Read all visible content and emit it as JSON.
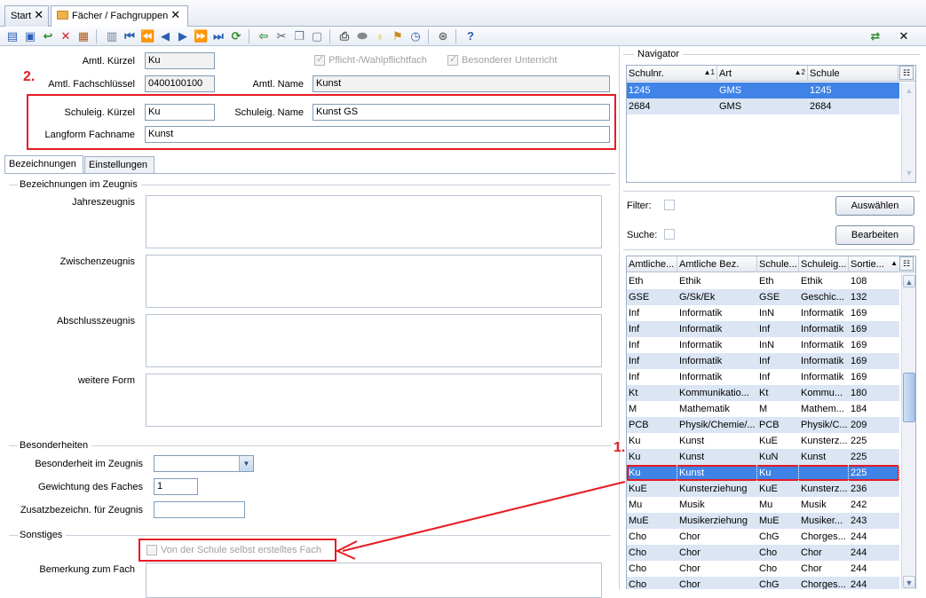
{
  "tabs": [
    {
      "label": "Start"
    },
    {
      "label": "Fächer / Fachgruppen"
    }
  ],
  "toolbar_icons": [
    "new-icon",
    "save-icon",
    "undo-icon",
    "delete-icon",
    "form-icon",
    "print-preview-icon",
    "first-icon",
    "prev-page-icon",
    "prev-icon",
    "next-icon",
    "next-page-icon",
    "last-icon",
    "refresh-icon",
    "back-arrow-icon",
    "cut-icon",
    "copy-icon",
    "paste-icon",
    "printer-icon",
    "toggle-icon",
    "lightbulb-icon",
    "broom-icon",
    "clock-icon",
    "filter-icon",
    "help-icon",
    "exchange-icon",
    "close-icon"
  ],
  "form": {
    "amtl_kuerzel_label": "Amtl. Kürzel",
    "amtl_kuerzel": "Ku",
    "pflicht_label": "Pflicht-/Wahlpflichtfach",
    "besonderer_label": "Besonderer Unterricht",
    "amtl_fachschluessel_label": "Amtl.  Fachschlüssel",
    "amtl_fachschluessel": "0400100100",
    "amtl_name_label": "Amtl. Name",
    "amtl_name": "Kunst",
    "schuleig_kuerzel_label": "Schuleig. Kürzel",
    "schuleig_kuerzel": "Ku",
    "schuleig_name_label": "Schuleig. Name",
    "schuleig_name": "Kunst GS",
    "langform_label": "Langform Fachname",
    "langform": "Kunst"
  },
  "markers": {
    "one": "1.",
    "two": "2."
  },
  "subtabs": [
    {
      "label": "Bezeichnungen"
    },
    {
      "label": "Einstellungen"
    }
  ],
  "sections": {
    "zeugnis_title": "Bezeichnungen im Zeugnis",
    "jahres": "Jahreszeugnis",
    "zwischen": "Zwischenzeugnis",
    "abschluss": "Abschlusszeugnis",
    "weitere": "weitere Form",
    "besonderheiten_title": "Besonderheiten",
    "besonderheit_label": "Besonderheit im Zeugnis",
    "gewichtung_label": "Gewichtung des Faches",
    "gewichtung": "1",
    "zusatz_label": "Zusatzbezeichn. für Zeugnis",
    "sonstiges_title": "Sonstiges",
    "selbst_label": "Von der Schule selbst erstelltes Fach",
    "bemerkung_label": "Bemerkung zum Fach"
  },
  "navigator": {
    "title": "Navigator",
    "columns": [
      "Schulnr.",
      "Art",
      "Schule"
    ],
    "sort_marks": [
      "▲1",
      "▲2"
    ],
    "rows": [
      {
        "schulnr": "1245",
        "art": "GMS",
        "schule": "1245"
      },
      {
        "schulnr": "2684",
        "art": "GMS",
        "schule": "2684"
      }
    ],
    "filter_label": "Filter:",
    "suche_label": "Suche:",
    "auswaehlen": "Auswählen",
    "bearbeiten": "Bearbeiten"
  },
  "subjects": {
    "columns": [
      "Amtliche...",
      "Amtliche Bez.",
      "Schule...",
      "Schuleig...",
      "Sortie..."
    ],
    "rows": [
      [
        "Eth",
        "Ethik",
        "Eth",
        "Ethik",
        "108"
      ],
      [
        "GSE",
        "G/Sk/Ek",
        "GSE",
        "Geschic...",
        "132"
      ],
      [
        "Inf",
        "Informatik",
        "InN",
        "Informatik",
        "169"
      ],
      [
        "Inf",
        "Informatik",
        "Inf",
        "Informatik",
        "169"
      ],
      [
        "Inf",
        "Informatik",
        "InN",
        "Informatik",
        "169"
      ],
      [
        "Inf",
        "Informatik",
        "Inf",
        "Informatik",
        "169"
      ],
      [
        "Inf",
        "Informatik",
        "Inf",
        "Informatik",
        "169"
      ],
      [
        "Kt",
        "Kommunikatio...",
        "Kt",
        "Kommu...",
        "180"
      ],
      [
        "M",
        "Mathematik",
        "M",
        "Mathem...",
        "184"
      ],
      [
        "PCB",
        "Physik/Chemie/...",
        "PCB",
        "Physik/C...",
        "209"
      ],
      [
        "Ku",
        "Kunst",
        "KuE",
        "Kunsterz...",
        "225"
      ],
      [
        "Ku",
        "Kunst",
        "KuN",
        "Kunst",
        "225"
      ],
      [
        "Ku",
        "Kunst",
        "Ku",
        "",
        "225"
      ],
      [
        "KuE",
        "Kunsterziehung",
        "KuE",
        "Kunsterz...",
        "236"
      ],
      [
        "Mu",
        "Musik",
        "Mu",
        "Musik",
        "242"
      ],
      [
        "MuE",
        "Musikerziehung",
        "MuE",
        "Musiker...",
        "243"
      ],
      [
        "Cho",
        "Chor",
        "ChG",
        "Chorges...",
        "244"
      ],
      [
        "Cho",
        "Chor",
        "Cho",
        "Chor",
        "244"
      ],
      [
        "Cho",
        "Chor",
        "Cho",
        "Chor",
        "244"
      ],
      [
        "Cho",
        "Chor",
        "ChG",
        "Chorges...",
        "244"
      ]
    ],
    "selected_index": 12
  }
}
